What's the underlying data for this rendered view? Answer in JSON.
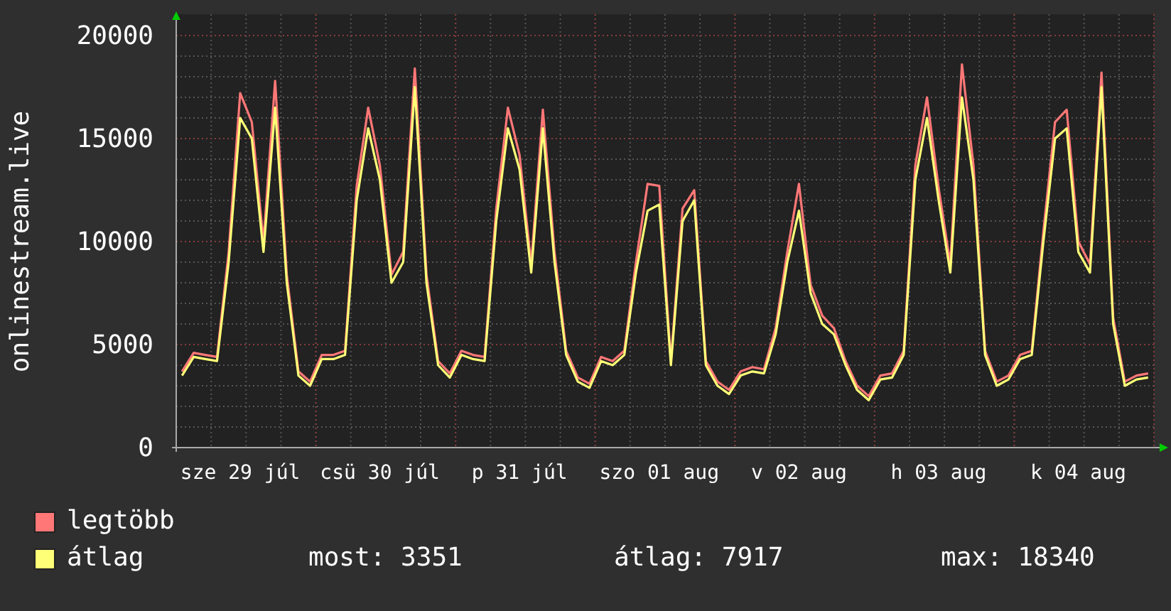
{
  "chart_data": {
    "type": "line",
    "ylabel": "onlinestream.live",
    "categories": [
      null,
      null,
      null,
      null,
      null,
      "sze 29 júl",
      null,
      null,
      null,
      null,
      null,
      null,
      null,
      null,
      null,
      null,
      null,
      "csü 30 júl",
      null,
      null,
      null,
      null,
      null,
      null,
      null,
      null,
      null,
      null,
      null,
      "p 31 júl",
      null,
      null,
      null,
      null,
      null,
      null,
      null,
      null,
      null,
      null,
      null,
      "szo 01 aug",
      null,
      null,
      null,
      null,
      null,
      null,
      null,
      null,
      null,
      null,
      null,
      "v 02 aug",
      null,
      null,
      null,
      null,
      null,
      null,
      null,
      null,
      null,
      null,
      null,
      "h 03 aug",
      null,
      null,
      null,
      null,
      null,
      null,
      null,
      null,
      null,
      null,
      null,
      "k 04 aug",
      null,
      null,
      null,
      null,
      null,
      null
    ],
    "series": [
      {
        "name": "legtöbb",
        "color": "#ff7777",
        "values": [
          3700,
          4600,
          4500,
          4400,
          9500,
          17200,
          15800,
          10000,
          17800,
          8400,
          3700,
          3200,
          4500,
          4500,
          4700,
          12700,
          16500,
          13700,
          8400,
          9500,
          18400,
          8400,
          4200,
          3600,
          4700,
          4500,
          4400,
          11600,
          16500,
          14200,
          8900,
          16400,
          9500,
          4700,
          3400,
          3100,
          4400,
          4200,
          4700,
          9000,
          12800,
          12700,
          4200,
          11600,
          12500,
          4200,
          3200,
          2800,
          3700,
          3900,
          3800,
          5800,
          9500,
          12800,
          7900,
          6400,
          5800,
          4200,
          3000,
          2500,
          3500,
          3600,
          4700,
          13700,
          17000,
          12600,
          8900,
          18600,
          13700,
          4700,
          3200,
          3500,
          4500,
          4700,
          10500,
          15800,
          16400,
          10000,
          8900,
          18200,
          6300,
          3200,
          3500,
          3600
        ]
      },
      {
        "name": "átlag",
        "color": "#ffff77",
        "values": [
          3500,
          4400,
          4300,
          4200,
          9000,
          16000,
          15000,
          9500,
          16500,
          8000,
          3500,
          3000,
          4300,
          4300,
          4500,
          12000,
          15500,
          13000,
          8000,
          9000,
          17500,
          8000,
          4000,
          3400,
          4500,
          4300,
          4200,
          11000,
          15500,
          13500,
          8500,
          15500,
          9000,
          4500,
          3200,
          2900,
          4200,
          4000,
          4500,
          8500,
          11500,
          11800,
          4000,
          11000,
          12000,
          4000,
          3000,
          2600,
          3500,
          3700,
          3600,
          5500,
          9000,
          11500,
          7500,
          6000,
          5500,
          4000,
          2800,
          2300,
          3300,
          3400,
          4500,
          13000,
          16000,
          12000,
          8500,
          17000,
          13000,
          4500,
          3000,
          3300,
          4300,
          4500,
          10000,
          15000,
          15500,
          9500,
          8500,
          17500,
          6000,
          3000,
          3300,
          3400
        ]
      }
    ],
    "grid": true,
    "ylim": [
      0,
      20000
    ],
    "yticks": [
      0,
      5000,
      10000,
      15000,
      20000
    ]
  },
  "summary": [
    "most: 3351",
    "átlag: 7917",
    "max: 18340"
  ]
}
